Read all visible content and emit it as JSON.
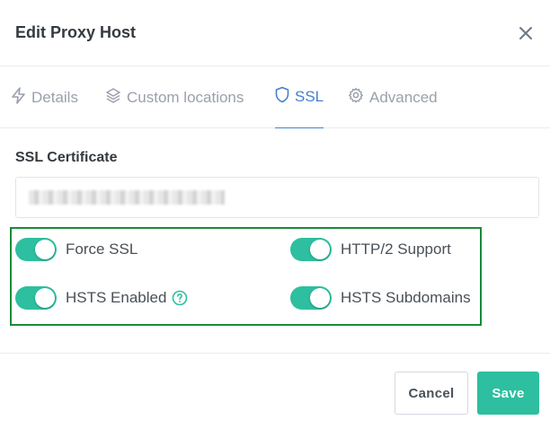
{
  "modal": {
    "title": "Edit Proxy Host",
    "close_icon": "close-icon"
  },
  "tabs": [
    {
      "label": "Details",
      "icon": "bolt-icon",
      "active": false
    },
    {
      "label": "Custom locations",
      "icon": "layers-icon",
      "active": false
    },
    {
      "label": "SSL",
      "icon": "shield-icon",
      "active": true
    },
    {
      "label": "Advanced",
      "icon": "gear-icon",
      "active": false
    }
  ],
  "ssl": {
    "certificate_label": "SSL Certificate",
    "options": [
      {
        "label": "Force SSL",
        "enabled": true
      },
      {
        "label": "HTTP/2 Support",
        "enabled": true
      },
      {
        "label": "HSTS Enabled",
        "enabled": true,
        "help_icon": "question-circle-icon"
      },
      {
        "label": "HSTS Subdomains",
        "enabled": true
      }
    ]
  },
  "footer": {
    "cancel_label": "Cancel",
    "save_label": "Save"
  },
  "colors": {
    "accent": "#467fcf",
    "toggle_on": "#2dbf9f",
    "save_button": "#2dbf9f",
    "highlight_border": "#1a8b3a"
  }
}
